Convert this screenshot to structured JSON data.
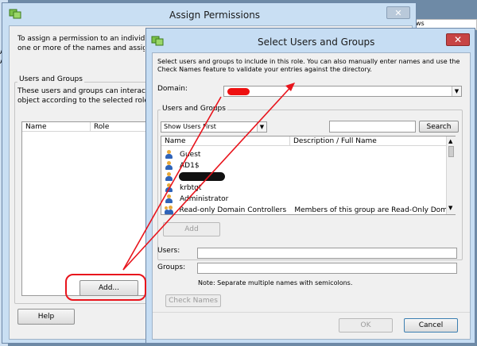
{
  "background_window": {
    "title": "Assign Permissions",
    "intro_text_1": "To assign a permission to an individual o",
    "intro_text_2": "one or more of the names and assign a",
    "users_groups_label": "Users and Groups",
    "users_groups_text_1": "These users and groups can interact wit",
    "users_groups_text_2": "object according to the selected role.",
    "columns": [
      "Name",
      "Role"
    ],
    "add_button": "Add...",
    "help_button": "Help",
    "side_letters": [
      "A",
      "A"
    ]
  },
  "background_tab_text": "ws",
  "dialog": {
    "title": "Select Users and Groups",
    "close_glyph": "✕",
    "description_1": "Select users and groups to include in this role. You can also manually enter names and use the",
    "description_2": "Check Names feature to validate your entries against the directory.",
    "domain_label": "Domain:",
    "users_groups_label": "Users and Groups",
    "filter_selected": "Show Users First",
    "search_value": "",
    "search_button": "Search",
    "list_columns": [
      "Name",
      "Description / Full Name"
    ],
    "list_items": [
      {
        "name": "Guest",
        "description": "",
        "icon": "user-icon"
      },
      {
        "name": "AD1$",
        "description": "",
        "icon": "user-icon"
      },
      {
        "name": "",
        "description": "",
        "icon": "user-icon"
      },
      {
        "name": "krbtgt",
        "description": "",
        "icon": "user-icon"
      },
      {
        "name": "Administrator",
        "description": "",
        "icon": "user-icon"
      },
      {
        "name": "Read-only Domain Controllers",
        "description": "Members of this group are Read-Only Doma...",
        "icon": "group-icon"
      }
    ],
    "add_button": "Add",
    "users_label": "Users:",
    "groups_label": "Groups:",
    "users_value": "",
    "groups_value": "",
    "note": "Note: Separate multiple names with semicolons.",
    "check_names_button": "Check Names",
    "ok_button": "OK",
    "cancel_button": "Cancel"
  },
  "annotation_color": "#e8141c",
  "accent_color": "#c9dff3"
}
